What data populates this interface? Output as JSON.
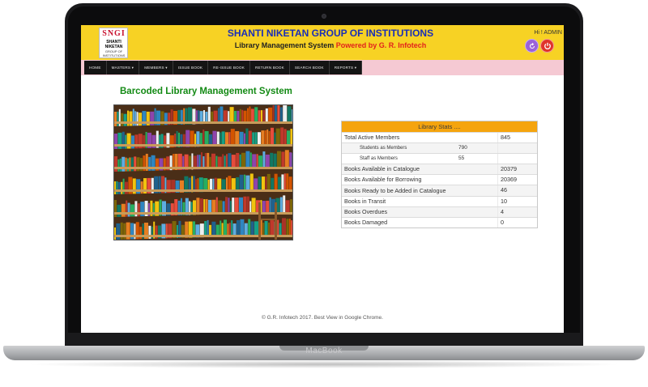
{
  "device": {
    "brand": "MacBook"
  },
  "header": {
    "logo": {
      "top": "SNGI",
      "mid": "SHANTI NIKETAN",
      "bottom": "GROUP OF INSTITUTIONS"
    },
    "title": "SHANTI NIKETAN GROUP OF INSTITUTIONS",
    "subtitle_main": "Library Management System",
    "subtitle_powered": "Powered by G. R. Infotech",
    "greeting": "Hi ! ADMIN",
    "refresh_icon": "refresh-icon",
    "power_icon": "power-icon"
  },
  "nav": {
    "items": [
      {
        "label": "HOME",
        "dropdown": false
      },
      {
        "label": "MASTERS ▾",
        "dropdown": true
      },
      {
        "label": "MEMBERS ▾",
        "dropdown": true
      },
      {
        "label": "ISSUE BOOK",
        "dropdown": false
      },
      {
        "label": "RE-ISSUE BOOK",
        "dropdown": false
      },
      {
        "label": "RETURN BOOK",
        "dropdown": false
      },
      {
        "label": "SEARCH BOOK",
        "dropdown": false
      },
      {
        "label": "REPORTS ▾",
        "dropdown": true
      }
    ]
  },
  "main": {
    "heading": "Barcoded Library Management System",
    "stats": {
      "title": "Library Stats ....",
      "total_active_members": {
        "label": "Total Active Members",
        "value": "845"
      },
      "students": {
        "label": "Students as Members",
        "value": "790"
      },
      "staff": {
        "label": "Staff as Members",
        "value": "55"
      },
      "catalogue": {
        "label": "Books Available in Catalogue",
        "value": "20379"
      },
      "borrowing": {
        "label": "Books Available for Borrowing",
        "value": "20369"
      },
      "ready": {
        "label": "Books Ready to be Added in Catalogue",
        "value": "46"
      },
      "transit": {
        "label": "Books in Transit",
        "value": "10"
      },
      "overdue": {
        "label": "Books Overdues",
        "value": "4"
      },
      "damaged": {
        "label": "Books Damaged",
        "value": "0"
      }
    }
  },
  "footer": {
    "text": "© G.R. Infotech 2017. Best View in Google Chrome."
  },
  "colors": {
    "header_bg": "#f7d224",
    "title": "#1a2eb8",
    "powered": "#e2211c",
    "nav_bg": "#141414",
    "nav_strip": "#f5c9d3",
    "heading": "#138a14",
    "stats_header": "#f5a40e"
  }
}
